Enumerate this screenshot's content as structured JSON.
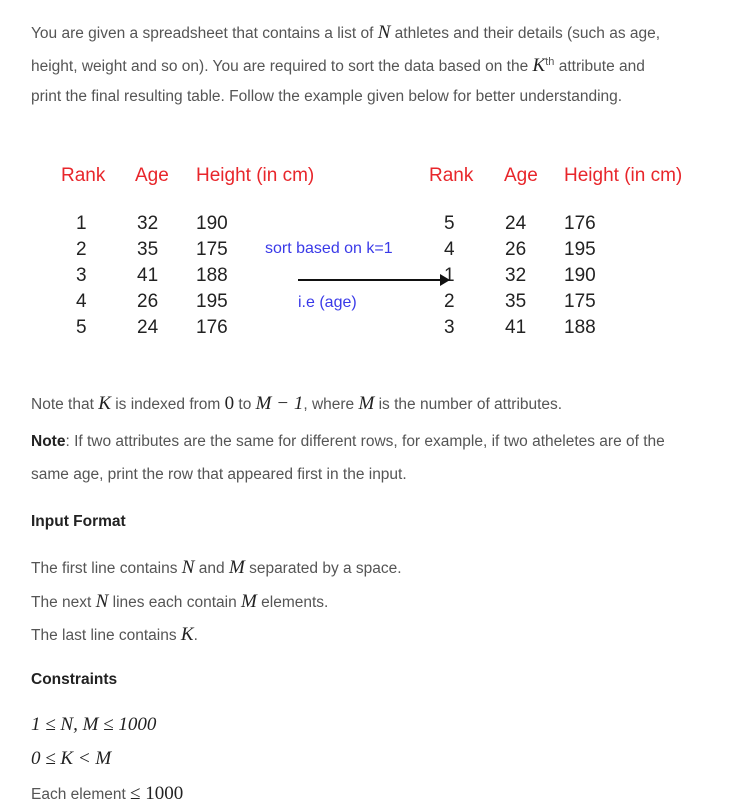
{
  "intro": {
    "l1a": "You are given a spreadsheet that contains a list of ",
    "N": "N",
    "l1b": " athletes and their details (such as age,",
    "l2a": "height, weight and so on). You are required to sort the data based on the ",
    "K": "K",
    "sup": "th",
    "l2b": " attribute and",
    "l3": "print the final resulting table. Follow the example given below for better understanding."
  },
  "figure": {
    "headers": [
      "Rank",
      "Age",
      "Height (in cm)"
    ],
    "left_rows": [
      [
        "1",
        "32",
        "190"
      ],
      [
        "2",
        "35",
        "175"
      ],
      [
        "3",
        "41",
        "188"
      ],
      [
        "4",
        "26",
        "195"
      ],
      [
        "5",
        "24",
        "176"
      ]
    ],
    "right_rows": [
      [
        "5",
        "24",
        "176"
      ],
      [
        "4",
        "26",
        "195"
      ],
      [
        "1",
        "32",
        "190"
      ],
      [
        "2",
        "35",
        "175"
      ],
      [
        "3",
        "41",
        "188"
      ]
    ],
    "arrow_top": "sort based on k=1",
    "arrow_bottom": "i.e (age)"
  },
  "note1": {
    "a": "Note that ",
    "K": "K",
    "b": " is indexed from ",
    "zero": "0",
    "c": " to ",
    "expr": "M − 1",
    "d": ", where ",
    "M": "M",
    "e": " is the number of attributes."
  },
  "note2": {
    "label": "Note",
    "l1": ": If two attributes are the same for different rows, for example, if two atheletes are of the",
    "l2": "same age, print the row that appeared first in the input."
  },
  "input_format": {
    "title": "Input Format",
    "l1a": "The first line contains ",
    "N": "N",
    "l1b": " and ",
    "M": "M",
    "l1c": " separated by a space.",
    "l2a": "The next ",
    "l2N": "N",
    "l2b": " lines each contain ",
    "l2M": "M",
    "l2c": " elements.",
    "l3a": "The last line contains ",
    "K": "K",
    "l3b": "."
  },
  "constraints": {
    "title": "Constraints",
    "c1": "1 ≤ N, M ≤ 1000",
    "c2": "0 ≤ K < M",
    "c3a": "Each element ",
    "c3b": "≤ 1000"
  }
}
